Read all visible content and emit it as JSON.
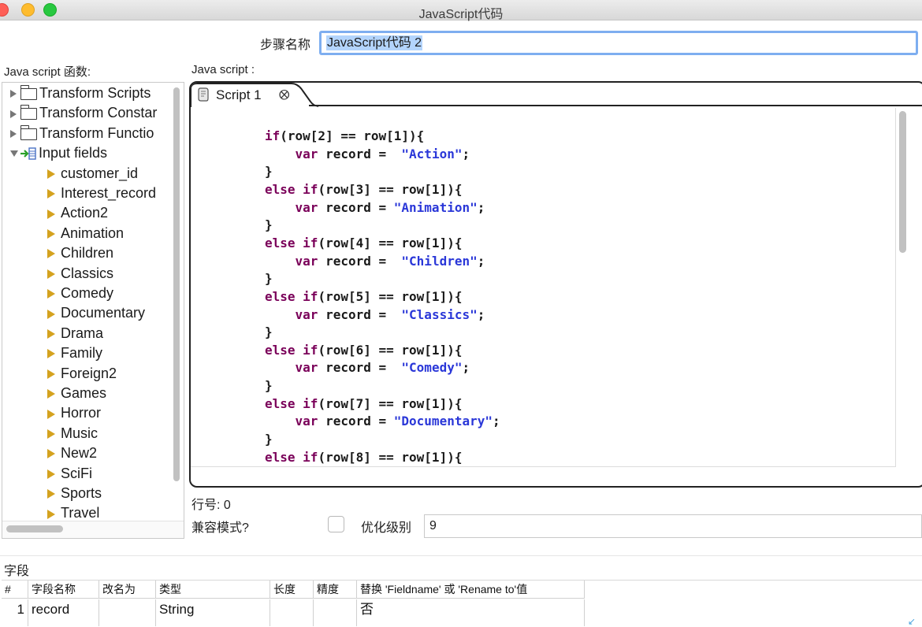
{
  "window": {
    "title": "JavaScript代码"
  },
  "step": {
    "label": "步骤名称",
    "value": "JavaScript代码 2"
  },
  "functions_panel": {
    "label": "Java script 函数:",
    "folders": [
      {
        "label": "Transform Scripts",
        "icon": "folder-icon"
      },
      {
        "label": "Transform Constar",
        "icon": "folder-icon"
      },
      {
        "label": "Transform Functio",
        "icon": "folder-icon"
      }
    ],
    "input_fields": {
      "label": "Input fields",
      "icon": "input-fields-icon",
      "items": [
        "customer_id",
        "Interest_record",
        "Action2",
        "Animation",
        "Children",
        "Classics",
        "Comedy",
        "Documentary",
        "Drama",
        "Family",
        "Foreign2",
        "Games",
        "Horror",
        "Music",
        "New2",
        "SciFi",
        "Sports",
        "Travel"
      ]
    }
  },
  "editor": {
    "label": "Java script :",
    "tab_label": "Script 1",
    "tab_close_icon": "close-icon",
    "code_lines": [
      [
        {
          "t": "if",
          "c": "kw"
        },
        {
          "t": "(row[2] == row[1]){",
          "c": ""
        }
      ],
      [
        {
          "t": "    ",
          "c": ""
        },
        {
          "t": "var",
          "c": "kw"
        },
        {
          "t": " record =  ",
          "c": ""
        },
        {
          "t": "\"Action\"",
          "c": "str"
        },
        {
          "t": ";",
          "c": ""
        }
      ],
      [
        {
          "t": "}",
          "c": ""
        }
      ],
      [
        {
          "t": "else",
          "c": "kw"
        },
        {
          "t": " ",
          "c": ""
        },
        {
          "t": "if",
          "c": "kw"
        },
        {
          "t": "(row[3] == row[1]){",
          "c": ""
        }
      ],
      [
        {
          "t": "    ",
          "c": ""
        },
        {
          "t": "var",
          "c": "kw"
        },
        {
          "t": " record = ",
          "c": ""
        },
        {
          "t": "\"Animation\"",
          "c": "str"
        },
        {
          "t": ";",
          "c": ""
        }
      ],
      [
        {
          "t": "}",
          "c": ""
        }
      ],
      [
        {
          "t": "else",
          "c": "kw"
        },
        {
          "t": " ",
          "c": ""
        },
        {
          "t": "if",
          "c": "kw"
        },
        {
          "t": "(row[4] == row[1]){",
          "c": ""
        }
      ],
      [
        {
          "t": "    ",
          "c": ""
        },
        {
          "t": "var",
          "c": "kw"
        },
        {
          "t": " record =  ",
          "c": ""
        },
        {
          "t": "\"Children\"",
          "c": "str"
        },
        {
          "t": ";",
          "c": ""
        }
      ],
      [
        {
          "t": "}",
          "c": ""
        }
      ],
      [
        {
          "t": "else",
          "c": "kw"
        },
        {
          "t": " ",
          "c": ""
        },
        {
          "t": "if",
          "c": "kw"
        },
        {
          "t": "(row[5] == row[1]){",
          "c": ""
        }
      ],
      [
        {
          "t": "    ",
          "c": ""
        },
        {
          "t": "var",
          "c": "kw"
        },
        {
          "t": " record =  ",
          "c": ""
        },
        {
          "t": "\"Classics\"",
          "c": "str"
        },
        {
          "t": ";",
          "c": ""
        }
      ],
      [
        {
          "t": "}",
          "c": ""
        }
      ],
      [
        {
          "t": "else",
          "c": "kw"
        },
        {
          "t": " ",
          "c": ""
        },
        {
          "t": "if",
          "c": "kw"
        },
        {
          "t": "(row[6] == row[1]){",
          "c": ""
        }
      ],
      [
        {
          "t": "    ",
          "c": ""
        },
        {
          "t": "var",
          "c": "kw"
        },
        {
          "t": " record =  ",
          "c": ""
        },
        {
          "t": "\"Comedy\"",
          "c": "str"
        },
        {
          "t": ";",
          "c": ""
        }
      ],
      [
        {
          "t": "}",
          "c": ""
        }
      ],
      [
        {
          "t": "else",
          "c": "kw"
        },
        {
          "t": " ",
          "c": ""
        },
        {
          "t": "if",
          "c": "kw"
        },
        {
          "t": "(row[7] == row[1]){",
          "c": ""
        }
      ],
      [
        {
          "t": "    ",
          "c": ""
        },
        {
          "t": "var",
          "c": "kw"
        },
        {
          "t": " record = ",
          "c": ""
        },
        {
          "t": "\"Documentary\"",
          "c": "str"
        },
        {
          "t": ";",
          "c": ""
        }
      ],
      [
        {
          "t": "}",
          "c": ""
        }
      ],
      [
        {
          "t": "else",
          "c": "kw"
        },
        {
          "t": " ",
          "c": ""
        },
        {
          "t": "if",
          "c": "kw"
        },
        {
          "t": "(row[8] == row[1]){",
          "c": ""
        }
      ]
    ]
  },
  "status": {
    "line_number_label": "行号: 0",
    "compat_label": "兼容模式?",
    "compat_checked": false,
    "optimization_label": "优化级别",
    "optimization_value": "9"
  },
  "fields": {
    "label": "字段",
    "columns": [
      "#",
      "字段名称",
      "改名为",
      "类型",
      "长度",
      "精度",
      "替换 'Fieldname' 或 'Rename to'值"
    ],
    "rows": [
      [
        "1",
        "record",
        "",
        "String",
        "",
        "",
        "否"
      ]
    ]
  },
  "colors": {
    "keyword": "#7a0059",
    "string": "#2a37d8",
    "selection": "#b3d4fc",
    "focus_border": "#7eaef0",
    "field_marker": "#d4a21f"
  }
}
